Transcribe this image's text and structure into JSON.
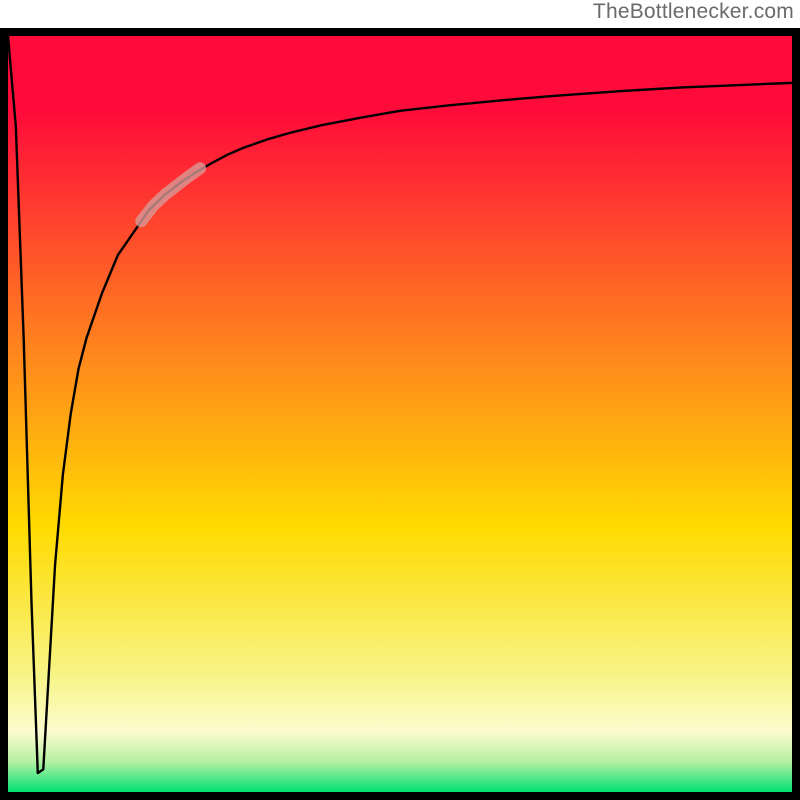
{
  "attribution": "TheBottlenecker.com",
  "chart_data": {
    "type": "line",
    "title": "",
    "xlabel": "",
    "ylabel": "",
    "xlim": [
      0,
      100
    ],
    "ylim": [
      0,
      100
    ],
    "grid": false,
    "legend": false,
    "background_gradient": {
      "top": "#ff0b3a",
      "upper_mid": "#ff7f1f",
      "mid": "#ffdb00",
      "lower_mid": "#f7f58a",
      "bottom": "#00e274"
    },
    "series": [
      {
        "name": "bottleneck-curve",
        "comment": "y is percent (0 = bottom/green, 100 = top/red). Chart shows a sharp V near x≈3–4 dipping to ~0, then a steep rise that flattens asymptotically near ~93–95.",
        "x": [
          0,
          1.0,
          2.0,
          3.0,
          3.8,
          4.5,
          5.0,
          6.0,
          7.0,
          8.0,
          9.0,
          10,
          12,
          14,
          16,
          18,
          20,
          22,
          24,
          26,
          28,
          30,
          33,
          36,
          40,
          45,
          50,
          56,
          63,
          70,
          78,
          86,
          93,
          100
        ],
        "y": [
          100,
          88,
          60,
          25,
          2.5,
          3.0,
          12,
          30,
          42,
          50,
          56,
          60,
          66,
          71,
          74,
          77,
          79,
          80.6,
          82,
          83.2,
          84.3,
          85.2,
          86.3,
          87.2,
          88.2,
          89.2,
          90.1,
          90.8,
          91.5,
          92.1,
          92.7,
          93.2,
          93.5,
          93.8
        ]
      },
      {
        "name": "highlight-segment",
        "comment": "A short faded/thicker segment overlaid on the curve roughly between x≈17 and x≈24 (upper-left of the rising limb).",
        "x": [
          17,
          18.5,
          20,
          21.5,
          23,
          24.5
        ],
        "y": [
          75.5,
          77.5,
          79,
          80.2,
          81.4,
          82.5
        ]
      }
    ]
  }
}
